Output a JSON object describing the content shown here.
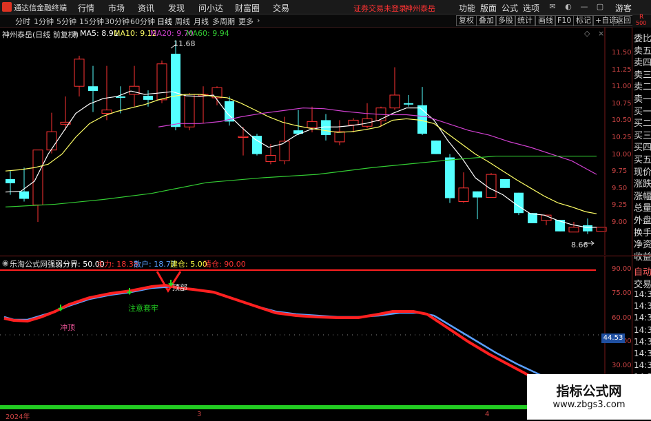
{
  "menubar": {
    "app_title": "通达信金融终端",
    "items": [
      "行情",
      "市场",
      "资讯",
      "发现",
      "问小达",
      "财富圈",
      "交易"
    ],
    "login_status": "证券交易未登录",
    "stock_name": "神州泰岳",
    "right_items": [
      "功能",
      "版面",
      "公式",
      "选项"
    ],
    "user": "游客"
  },
  "toolbar": {
    "periods": [
      "分时",
      "1分钟",
      "5分钟",
      "15分钟",
      "30分钟",
      "60分钟",
      "日线",
      "周线",
      "月线",
      "多周期",
      "更多"
    ],
    "active_period": "日线",
    "right_buttons": [
      "复权",
      "叠加",
      "多股",
      "统计",
      "画线",
      "F10",
      "标记",
      "+自选",
      "返回"
    ],
    "corner_badge_top": "R",
    "corner_badge_bottom": "500"
  },
  "main_chart": {
    "title": "神州泰岳(日线 前复权)",
    "ma": [
      {
        "label": "MA5: 8.91",
        "color": "#ffffff"
      },
      {
        "label": "MA10: 9.12",
        "color": "#ffff66"
      },
      {
        "label": "MA20: 9.70",
        "color": "#d040d0"
      },
      {
        "label": "MA60: 9.94",
        "color": "#33cc33"
      }
    ],
    "high_mark": "11.68",
    "low_mark": "8.66",
    "y_ticks": [
      "11.50",
      "11.25",
      "11.00",
      "10.75",
      "10.50",
      "10.25",
      "10.00",
      "9.75",
      "9.50",
      "9.25",
      "9.00"
    ]
  },
  "indicator": {
    "title": "乐淘公式网",
    "items": [
      {
        "label": "强弱分界: 50.00",
        "color": "#ffffff"
      },
      {
        "label": "主力: 18.38",
        "color": "#ff3333"
      },
      {
        "label": "散户: 18.77",
        "color": "#5aa0ff"
      },
      {
        "label": "建仓: 5.00",
        "color": "#ffff44"
      },
      {
        "label": "清仓: 90.00",
        "color": "#ff3333"
      }
    ],
    "annotations": [
      "冲顶",
      "注意套牢",
      "顶部"
    ],
    "y_ticks": [
      "90.00",
      "75.00",
      "60.00",
      "45.00",
      "30.00"
    ],
    "current_value": "44.53"
  },
  "x_axis": {
    "labels": [
      "2024年",
      "3",
      "4"
    ]
  },
  "right_panel": {
    "items": [
      "委比",
      "卖五",
      "卖四",
      "卖三",
      "卖二",
      "卖一",
      "买一",
      "买二",
      "买三",
      "买四",
      "买五",
      "现价",
      "涨跌",
      "涨幅",
      "总量",
      "外盘",
      "换手",
      "净资",
      "收益"
    ],
    "trade_items": [
      "自动",
      "交易"
    ],
    "times": [
      "14:39",
      "14:39",
      "14:39",
      "14:39",
      "14:39",
      "14:39",
      "14:39",
      "14:39",
      "14:39",
      "14:39",
      "14:39"
    ]
  },
  "watermark": {
    "line1": "指标公式网",
    "line2": "www.zbgs3.com"
  },
  "colors": {
    "up_candle": "#ff3333",
    "down_candle": "#54ffff",
    "panel_border": "#7a1a1a"
  }
}
